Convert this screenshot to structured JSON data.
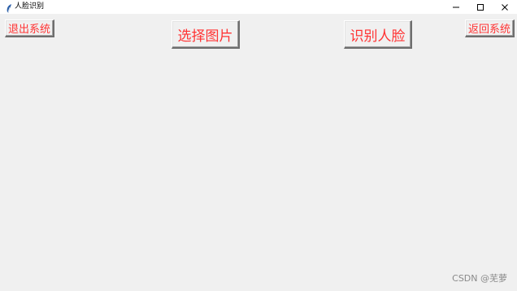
{
  "window": {
    "title": "人脸识别",
    "icon": "feather-icon",
    "controls": [
      "minimize-icon",
      "maximize-icon",
      "close-icon"
    ]
  },
  "buttons": {
    "exit": "退出系统",
    "select_image": "选择图片",
    "recognize_face": "识别人脸",
    "return": "返回系统"
  },
  "colors": {
    "button_text": "#ff3333",
    "background": "#f0f0f0"
  },
  "watermark": "CSDN @芜萝"
}
